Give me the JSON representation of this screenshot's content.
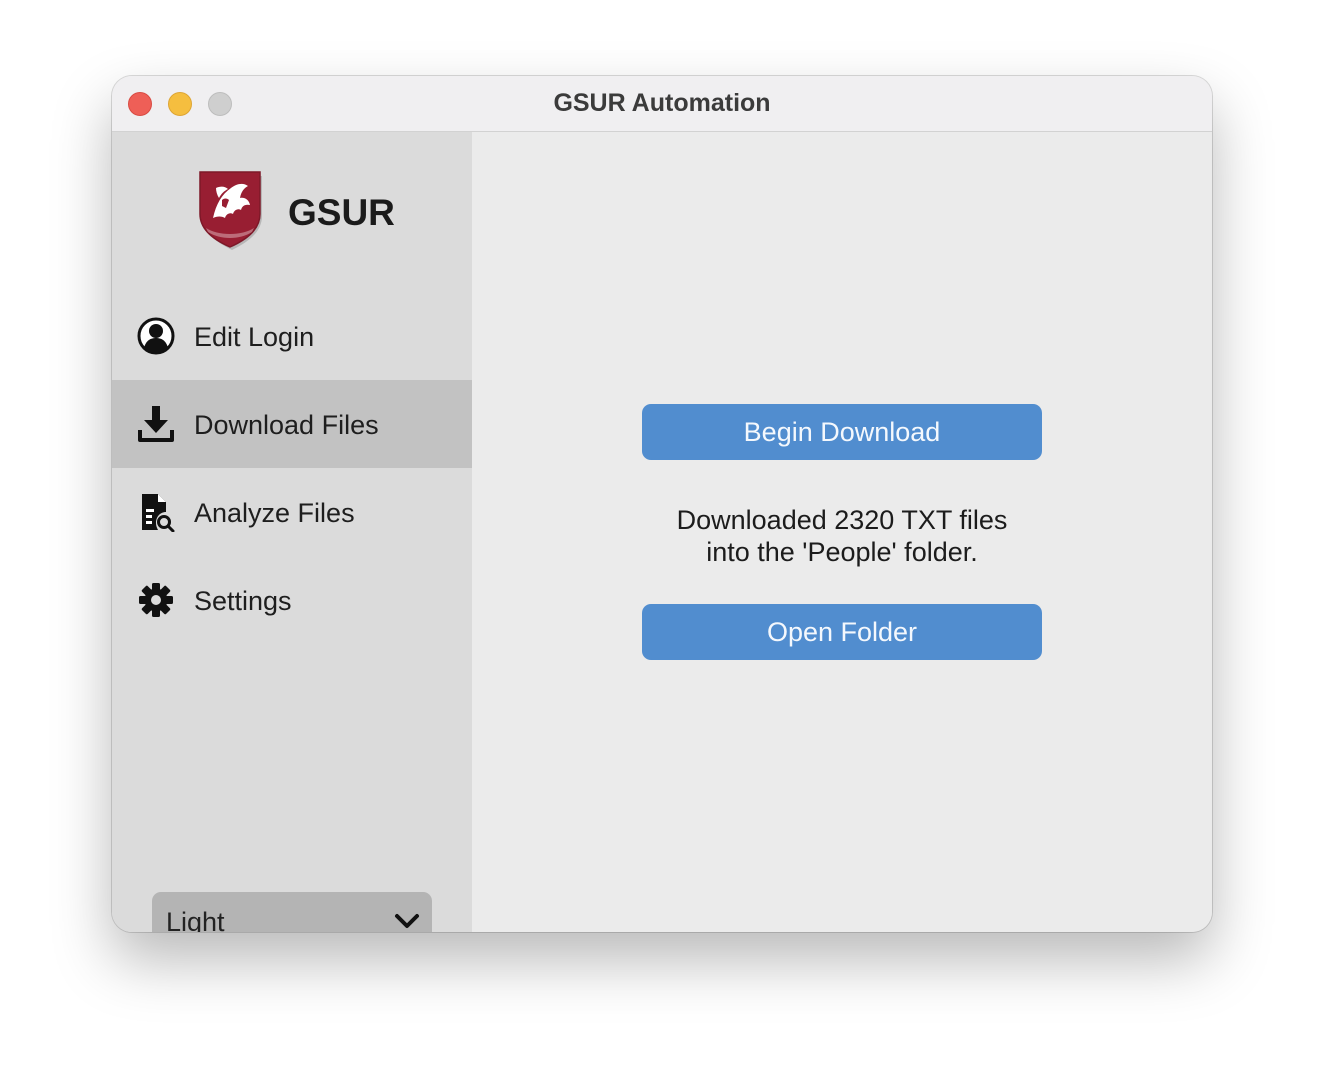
{
  "window": {
    "title": "GSUR Automation"
  },
  "sidebar": {
    "brand": "GSUR",
    "items": [
      {
        "label": "Edit Login",
        "icon": "user-circle-icon",
        "active": false
      },
      {
        "label": "Download Files",
        "icon": "download-icon",
        "active": true
      },
      {
        "label": "Analyze Files",
        "icon": "analyze-file-icon",
        "active": false
      },
      {
        "label": "Settings",
        "icon": "gear-icon",
        "active": false
      }
    ],
    "appearance": {
      "selected": "Light"
    }
  },
  "main": {
    "begin_button": "Begin Download",
    "status_line1": "Downloaded 2320 TXT files",
    "status_line2": "into the 'People' folder.",
    "open_button": "Open Folder"
  },
  "colors": {
    "accent": "#518dcf",
    "sidebar_bg": "#dbdbdb",
    "sidebar_active": "#c2c2c2",
    "logo_crimson": "#981e32"
  }
}
